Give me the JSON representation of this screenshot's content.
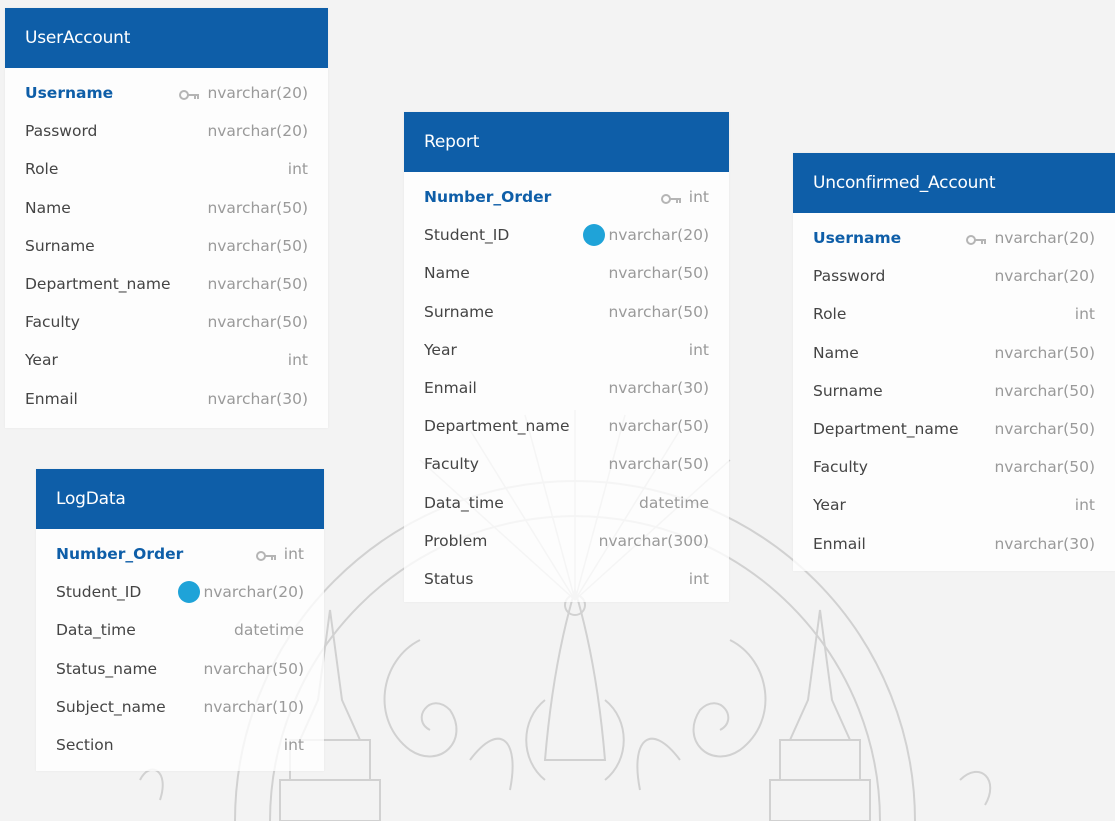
{
  "colors": {
    "header": "#0e5ea8",
    "fk_dot": "#1fa3d8",
    "pk_text": "#0e5ea8"
  },
  "tables": {
    "useraccount": {
      "title": "UserAccount",
      "columns": [
        {
          "name": "Username",
          "type": "nvarchar(20)",
          "pk": true
        },
        {
          "name": "Password",
          "type": "nvarchar(20)"
        },
        {
          "name": "Role",
          "type": "int"
        },
        {
          "name": "Name",
          "type": "nvarchar(50)"
        },
        {
          "name": "Surname",
          "type": "nvarchar(50)"
        },
        {
          "name": "Department_name",
          "type": "nvarchar(50)"
        },
        {
          "name": "Faculty",
          "type": "nvarchar(50)"
        },
        {
          "name": "Year",
          "type": "int"
        },
        {
          "name": "Enmail",
          "type": "nvarchar(30)"
        }
      ]
    },
    "logdata": {
      "title": "LogData",
      "columns": [
        {
          "name": "Number_Order",
          "type": "int",
          "pk": true
        },
        {
          "name": "Student_ID",
          "type": "nvarchar(20)",
          "fk": true
        },
        {
          "name": "Data_time",
          "type": "datetime"
        },
        {
          "name": "Status_name",
          "type": "nvarchar(50)"
        },
        {
          "name": "Subject_name",
          "type": "nvarchar(10)"
        },
        {
          "name": "Section",
          "type": "int"
        }
      ]
    },
    "report": {
      "title": "Report",
      "columns": [
        {
          "name": "Number_Order",
          "type": "int",
          "pk": true
        },
        {
          "name": "Student_ID",
          "type": "nvarchar(20)",
          "fk": true
        },
        {
          "name": "Name",
          "type": "nvarchar(50)"
        },
        {
          "name": "Surname",
          "type": "nvarchar(50)"
        },
        {
          "name": "Year",
          "type": "int"
        },
        {
          "name": "Enmail",
          "type": "nvarchar(30)"
        },
        {
          "name": "Department_name",
          "type": "nvarchar(50)"
        },
        {
          "name": "Faculty",
          "type": "nvarchar(50)"
        },
        {
          "name": "Data_time",
          "type": "datetime"
        },
        {
          "name": "Problem",
          "type": "nvarchar(300)"
        },
        {
          "name": "Status",
          "type": "int"
        }
      ]
    },
    "unconfirmed": {
      "title": "Unconfirmed_Account",
      "columns": [
        {
          "name": "Username",
          "type": "nvarchar(20)",
          "pk": true
        },
        {
          "name": "Password",
          "type": "nvarchar(20)"
        },
        {
          "name": "Role",
          "type": "int"
        },
        {
          "name": "Name",
          "type": "nvarchar(50)"
        },
        {
          "name": "Surname",
          "type": "nvarchar(50)"
        },
        {
          "name": "Department_name",
          "type": "nvarchar(50)"
        },
        {
          "name": "Faculty",
          "type": "nvarchar(50)"
        },
        {
          "name": "Year",
          "type": "int"
        },
        {
          "name": "Enmail",
          "type": "nvarchar(30)"
        }
      ]
    }
  }
}
